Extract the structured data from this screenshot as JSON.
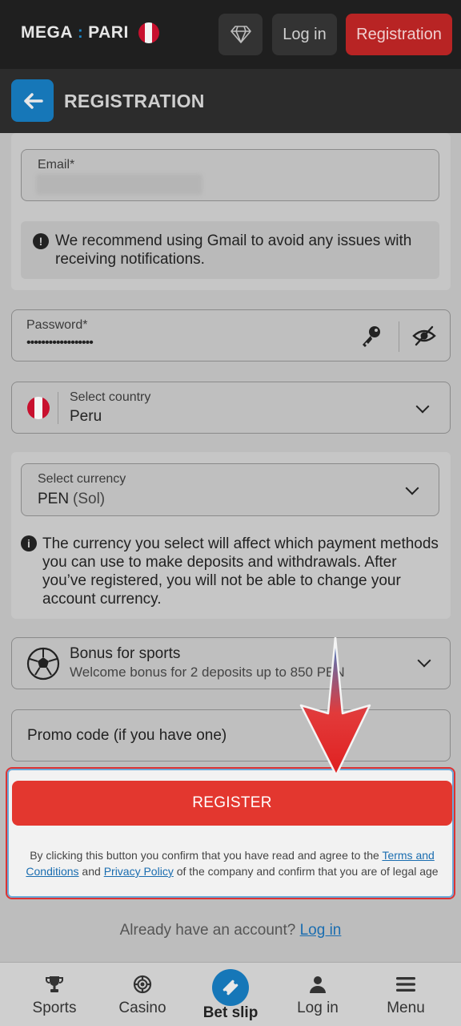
{
  "header": {
    "logo_left": "MEGA",
    "logo_sep": ":",
    "logo_right": "PARI",
    "login_label": "Log in",
    "registration_label": "Registration"
  },
  "subheader": {
    "title": "REGISTRATION"
  },
  "email": {
    "label": "Email*",
    "notice": "We recommend using Gmail to avoid any issues with receiving notifications."
  },
  "password": {
    "label": "Password*",
    "value": "••••••••••••••••••"
  },
  "country": {
    "label": "Select country",
    "value": "Peru"
  },
  "currency": {
    "label": "Select currency",
    "code": "PEN",
    "name": "(Sol)",
    "notice": "The currency you select will affect which payment methods you can use to make deposits and withdrawals. After you’ve registered, you will not be able to change your account currency."
  },
  "bonus": {
    "title": "Bonus for sports",
    "subtitle": "Welcome bonus for 2 deposits up to 850 PEN"
  },
  "promo": {
    "placeholder": "Promo code (if you have one)"
  },
  "register": {
    "button_label": "REGISTER",
    "terms_prefix": "By clicking this button you confirm that you have read and agree to the ",
    "terms_link": "Terms and Conditions",
    "terms_and": " and ",
    "privacy_link": "Privacy Policy",
    "terms_suffix": " of the company and confirm that you are of legal age"
  },
  "already": {
    "text": "Already have an account? ",
    "link": "Log in"
  },
  "nav": {
    "sports": "Sports",
    "casino": "Casino",
    "betslip": "Bet slip",
    "login": "Log in",
    "menu": "Menu"
  },
  "colors": {
    "accent_red": "#e3372f",
    "accent_blue": "#1677b8"
  }
}
